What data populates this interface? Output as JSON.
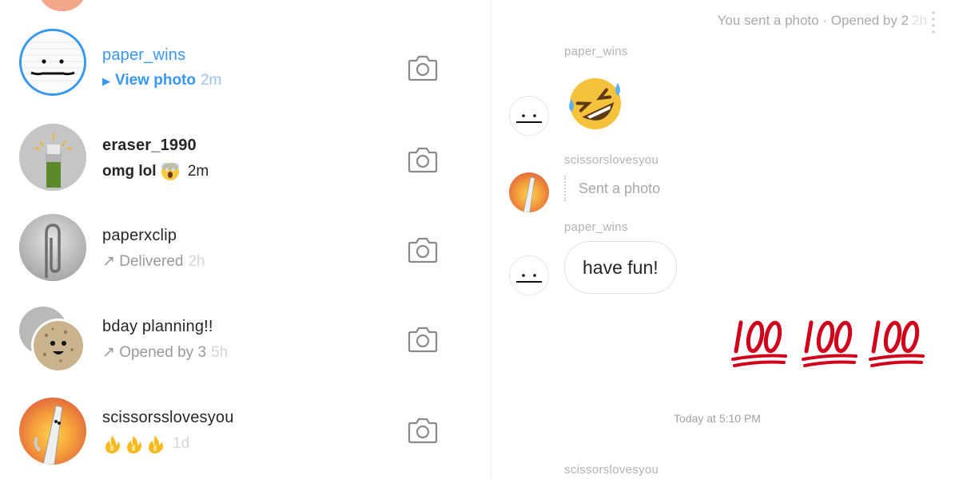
{
  "threads": [
    {
      "username": "paper_wins",
      "preview": "View photo",
      "time": "2m",
      "avatar_icon": "face-icon",
      "active": true
    },
    {
      "username": "eraser_1990",
      "preview": "omg lol",
      "preview_emoji": "scream-emoji-icon",
      "time": "2m",
      "avatar_icon": "pencil-eraser-icon"
    },
    {
      "username": "paperxclip",
      "preview": "Delivered",
      "time": "2h",
      "avatar_icon": "paperclip-icon"
    },
    {
      "username": "bday planning!!",
      "preview": "Opened by 3",
      "time": "5h",
      "avatar_icon": "group-avatar-icon"
    },
    {
      "username": "scissorsslovesyou",
      "preview_emoji": "fire-emoji-icon x3",
      "time": "1d",
      "avatar_icon": "scissors-icon"
    }
  ],
  "chat": {
    "status_line": "You sent a photo · Opened by 2",
    "status_time": "2h",
    "messages": [
      {
        "sender": "paper_wins",
        "type": "emoji",
        "emoji": "rolling-laughing-emoji-icon"
      },
      {
        "sender": "scissorslovesyou",
        "type": "system",
        "text": "Sent a photo"
      },
      {
        "sender": "paper_wins",
        "type": "text",
        "text": "have fun!"
      },
      {
        "sender": "me",
        "type": "emoji",
        "emoji": "hundred-points-emoji-icon x3"
      }
    ],
    "day_stamp": "Today at 5:10 PM",
    "next_sender": "scissorslovesyou"
  },
  "colors": {
    "accent_blue": "#3897f0",
    "muted": "#999999",
    "hundred_red": "#d0021b",
    "fire_yellow": "#f9c31d"
  }
}
